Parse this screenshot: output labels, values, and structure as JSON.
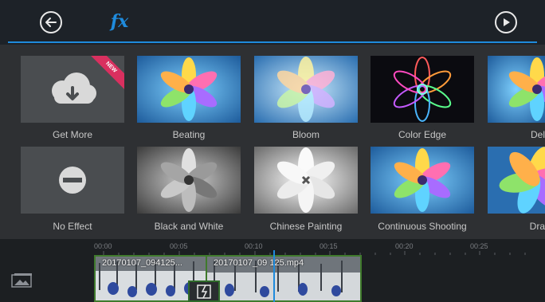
{
  "topbar": {
    "back_icon": "back-arrow-icon",
    "fx_label": "fx",
    "play_icon": "play-icon"
  },
  "effects": {
    "row1": [
      {
        "label": "Get More",
        "badge": "NEW"
      },
      {
        "label": "Beating"
      },
      {
        "label": "Bloom"
      },
      {
        "label": "Color Edge"
      },
      {
        "label": "Del"
      }
    ],
    "row2": [
      {
        "label": "No Effect"
      },
      {
        "label": "Black and White"
      },
      {
        "label": "Chinese Painting"
      },
      {
        "label": "Continuous Shooting"
      },
      {
        "label": "Dra"
      }
    ]
  },
  "timeline": {
    "ticks": [
      "00:00",
      "00:05",
      "00:10",
      "00:15",
      "00:20",
      "00:25"
    ],
    "clips": [
      {
        "name": "20170107_094125..."
      },
      {
        "name": "20170107_09 125.mp4"
      }
    ]
  },
  "colors": {
    "accent": "#1f8bdc",
    "topbar": "#1d2228",
    "badge": "#d9305f"
  }
}
